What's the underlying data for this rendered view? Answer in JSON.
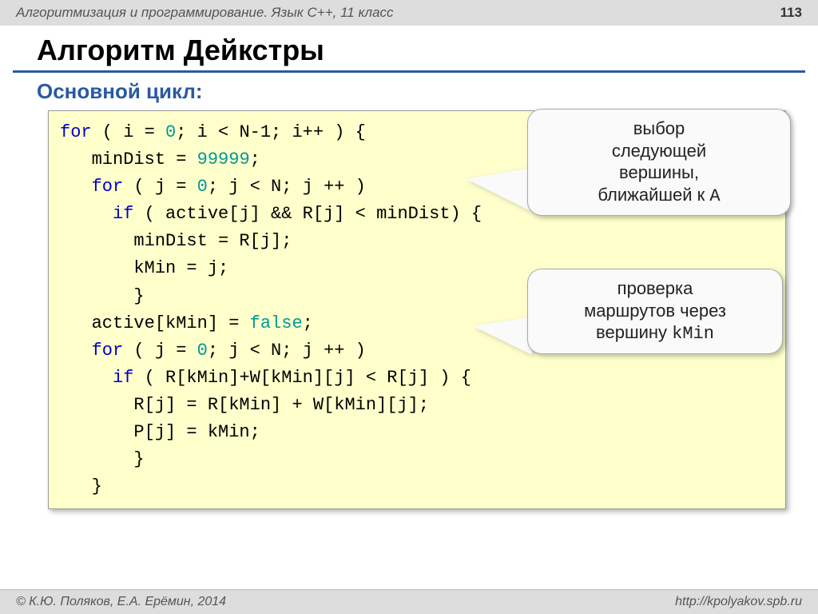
{
  "header": {
    "subject": "Алгоритмизация и программирование. Язык C++, 11 класс",
    "page": "113"
  },
  "title": "Алгоритм Дейкстры",
  "subtitle": "Основной цикл:",
  "code": {
    "l1a": "for",
    "l1b": " ( i = ",
    "l1c": "0",
    "l1d": "; i < N-1; i++ ) {",
    "l2a": "   minDist = ",
    "l2b": "99999",
    "l2c": ";",
    "l3a": "   ",
    "l3b": "for",
    "l3c": " ( j = ",
    "l3d": "0",
    "l3e": "; j < N; j ++ )",
    "l4a": "     ",
    "l4b": "if",
    "l4c": " ( active[j] && R[j] < minDist) {",
    "l5": "       minDist = R[j];",
    "l6": "       kMin = j;",
    "l7": "       }",
    "l8a": "   active[kMin] = ",
    "l8b": "false",
    "l8c": ";",
    "l9a": "   ",
    "l9b": "for",
    "l9c": " ( j = ",
    "l9d": "0",
    "l9e": "; j < N; j ++ )",
    "l10a": "     ",
    "l10b": "if",
    "l10c": " ( R[kMin]+W[kMin][j] < R[j] ) {",
    "l11": "       R[j] = R[kMin] + W[kMin][j];",
    "l12": "       P[j] = kMin;",
    "l13": "       }",
    "l14": "   }"
  },
  "callouts": {
    "c1_l1": "выбор",
    "c1_l2": "следующей",
    "c1_l3": "вершины,",
    "c1_l4a": "ближайшей к ",
    "c1_l4b": "A",
    "c2_l1": "проверка",
    "c2_l2": "маршрутов через",
    "c2_l3a": "вершину ",
    "c2_l3b": "kMin"
  },
  "footer": {
    "left": "© К.Ю. Поляков, Е.А. Ерёмин, 2014",
    "right": "http://kpolyakov.spb.ru"
  }
}
